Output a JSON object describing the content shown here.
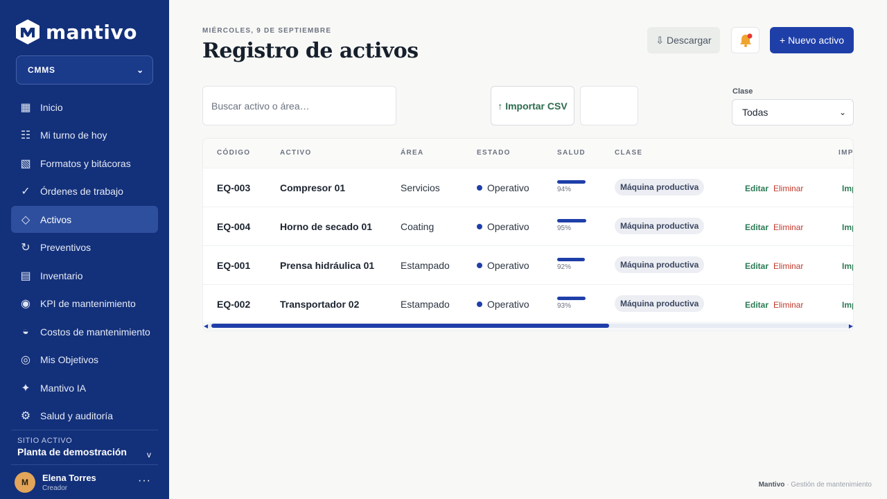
{
  "app": {
    "brand": "mantivo",
    "module": "CMMS"
  },
  "sidebar": {
    "items": [
      {
        "label": "Inicio",
        "icon": "▦"
      },
      {
        "label": "Mi turno de hoy",
        "icon": "☷"
      },
      {
        "label": "Formatos y bitácoras",
        "icon": "▧"
      },
      {
        "label": "Órdenes de trabajo",
        "icon": "✓"
      },
      {
        "label": "Activos",
        "icon": "◇"
      },
      {
        "label": "Preventivos",
        "icon": "↻"
      },
      {
        "label": "Inventario",
        "icon": "▤"
      },
      {
        "label": "KPI de mantenimiento",
        "icon": "◉"
      },
      {
        "label": "Costos de mantenimiento",
        "icon": "◒"
      },
      {
        "label": "Mis Objetivos",
        "icon": "◎"
      },
      {
        "label": "Mantivo IA",
        "icon": "✦"
      },
      {
        "label": "Salud y auditoría",
        "icon": "⚙"
      }
    ],
    "site": {
      "label": "SITIO ACTIVO",
      "name": "Planta de demostración"
    },
    "user": {
      "initial": "M",
      "name": "Elena Torres",
      "role": "Creador"
    }
  },
  "header": {
    "date": "MIÉRCOLES, 9 DE SEPTIEMBRE",
    "title": "Registro de activos",
    "download_label": "⇩ Descargar",
    "new_label": "+ Nuevo activo"
  },
  "filters": {
    "search_placeholder": "Buscar activo o área…",
    "import_label": "↑ Importar CSV",
    "class_label": "Clase",
    "class_value": "Todas"
  },
  "table": {
    "columns": [
      "CÓDIGO",
      "ACTIVO",
      "ÁREA",
      "ESTADO",
      "SALUD",
      "CLASE",
      "IMP"
    ],
    "edit_label": "Editar",
    "delete_label": "Eliminar",
    "imp_label": "Imp",
    "rows": [
      {
        "code": "EQ-003",
        "asset": "Compresor 01",
        "area": "Servicios",
        "state": "Operativo",
        "health": 94,
        "health_label": "94%",
        "class": "Máquina productiva"
      },
      {
        "code": "EQ-004",
        "asset": "Horno de secado 01",
        "area": "Coating",
        "state": "Operativo",
        "health": 95,
        "health_label": "95%",
        "class": "Máquina productiva"
      },
      {
        "code": "EQ-001",
        "asset": "Prensa hidráulica 01",
        "area": "Estampado",
        "state": "Operativo",
        "health": 92,
        "health_label": "92%",
        "class": "Máquina productiva"
      },
      {
        "code": "EQ-002",
        "asset": "Transportador 02",
        "area": "Estampado",
        "state": "Operativo",
        "health": 93,
        "health_label": "93%",
        "class": "Máquina productiva"
      }
    ]
  },
  "footer": {
    "brand": "Mantivo",
    "text": "· Gestión de mantenimiento"
  },
  "colors": {
    "sidebar": "#13307a",
    "accent": "#1f3fa8",
    "edit": "#2b7a55",
    "delete": "#c0392b"
  }
}
